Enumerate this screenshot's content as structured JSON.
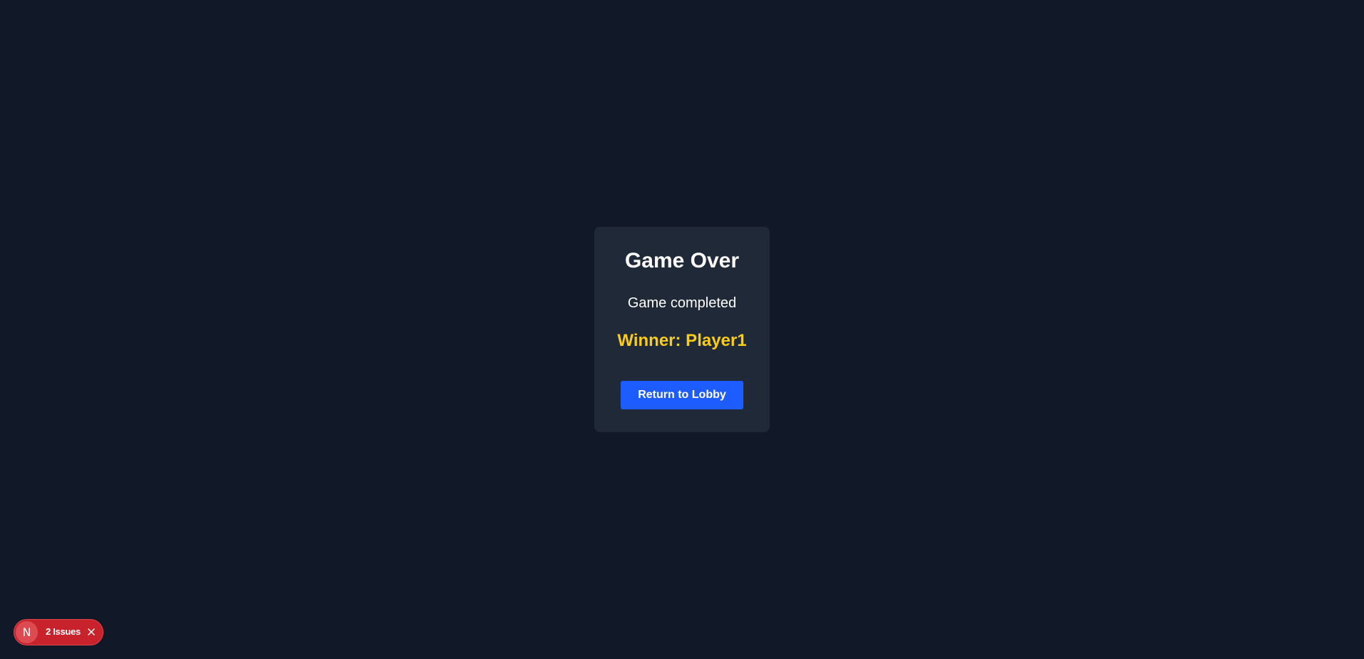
{
  "modal": {
    "title": "Game Over",
    "message": "Game completed",
    "winner_text": "Winner: Player1",
    "button_label": "Return to Lobby"
  },
  "dev_overlay": {
    "logo_letter": "N",
    "issues_label": "2 Issues",
    "close_icon": "close-icon"
  },
  "colors": {
    "background": "#111827",
    "card": "#1f2937",
    "winner": "#facc15",
    "button": "#1d5cff",
    "issues_pill": "#c8232c"
  }
}
